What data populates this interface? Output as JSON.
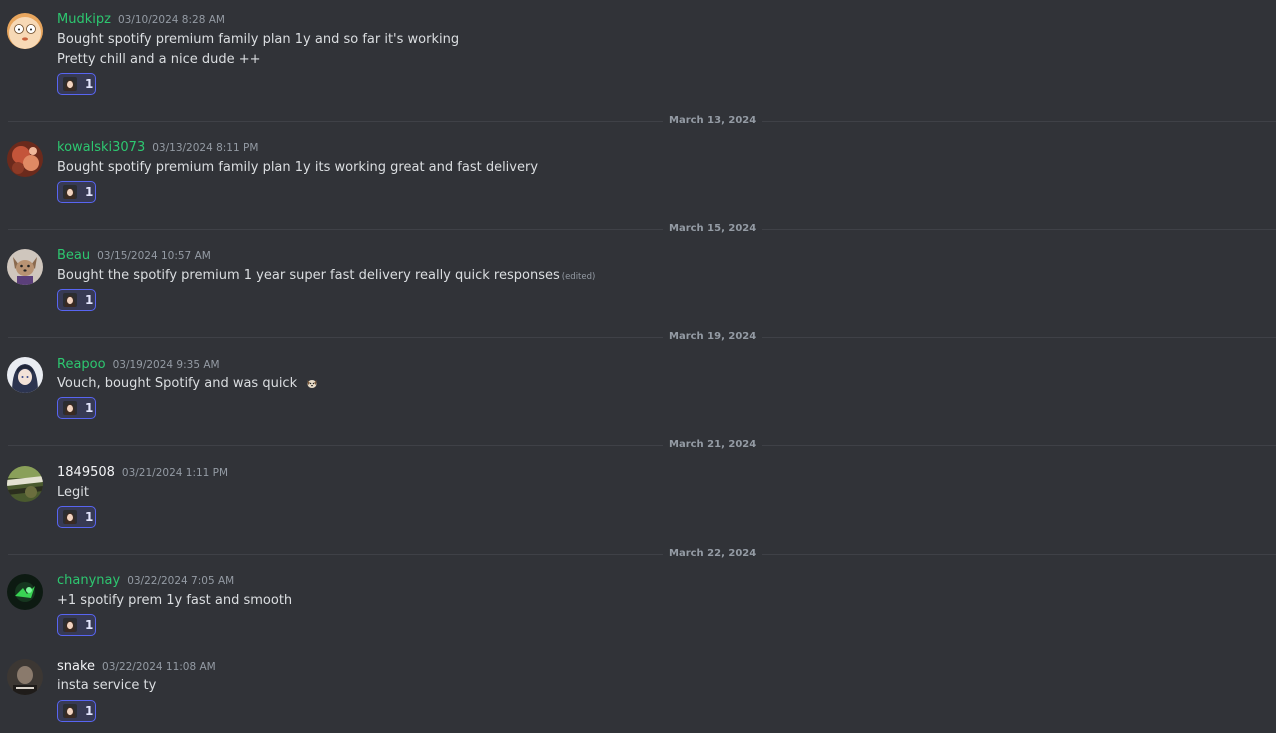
{
  "reaction_emoji": "girl-face-emoji",
  "messages": [
    {
      "username": "Mudkipz",
      "username_color": "#2dc770",
      "timestamp": "03/10/2024 8:28 AM",
      "lines": [
        "Bought spotify premium family plan 1y and so far it's working",
        "Pretty chill and a nice dude ++"
      ],
      "reaction_count": "1",
      "avatar": "cartoon-face-avatar"
    },
    {
      "divider": "March 13, 2024",
      "username": "kowalski3073",
      "username_color": "#2dc770",
      "timestamp": "03/13/2024 8:11 PM",
      "lines": [
        "Bought spotify premium family plan 1y its working great and fast delivery"
      ],
      "reaction_count": "1",
      "avatar": "red-photo-avatar"
    },
    {
      "divider": "March 15, 2024",
      "username": "Beau",
      "username_color": "#2dc770",
      "timestamp": "03/15/2024 10:57 AM",
      "lines": [
        "Bought the spotify premium 1 year super fast delivery really quick responses"
      ],
      "edited": "(edited)",
      "reaction_count": "1",
      "avatar": "dog-avatar"
    },
    {
      "divider": "March 19, 2024",
      "username": "Reapoo",
      "username_color": "#2dc770",
      "timestamp": "03/19/2024 9:35 AM",
      "lines": [
        "Vouch, bought Spotify and was quick"
      ],
      "inline_emoji": "dog-emoji",
      "reaction_count": "1",
      "avatar": "anime-avatar"
    },
    {
      "divider": "March 21, 2024",
      "username": "1849508",
      "username_color": "#f2f3f5",
      "timestamp": "03/21/2024 1:11 PM",
      "lines": [
        "Legit"
      ],
      "reaction_count": "1",
      "avatar": "nature-photo-avatar"
    },
    {
      "divider": "March 22, 2024",
      "username": "chanynay",
      "username_color": "#2dc770",
      "timestamp": "03/22/2024 7:05 AM",
      "lines": [
        "+1 spotify prem 1y fast and smooth"
      ],
      "reaction_count": "1",
      "avatar": "green-glow-avatar"
    },
    {
      "username": "snake",
      "username_color": "#f2f3f5",
      "timestamp": "03/22/2024 11:08 AM",
      "lines": [
        "insta service ty"
      ],
      "reaction_count": "1",
      "avatar": "dark-photo-avatar"
    }
  ]
}
